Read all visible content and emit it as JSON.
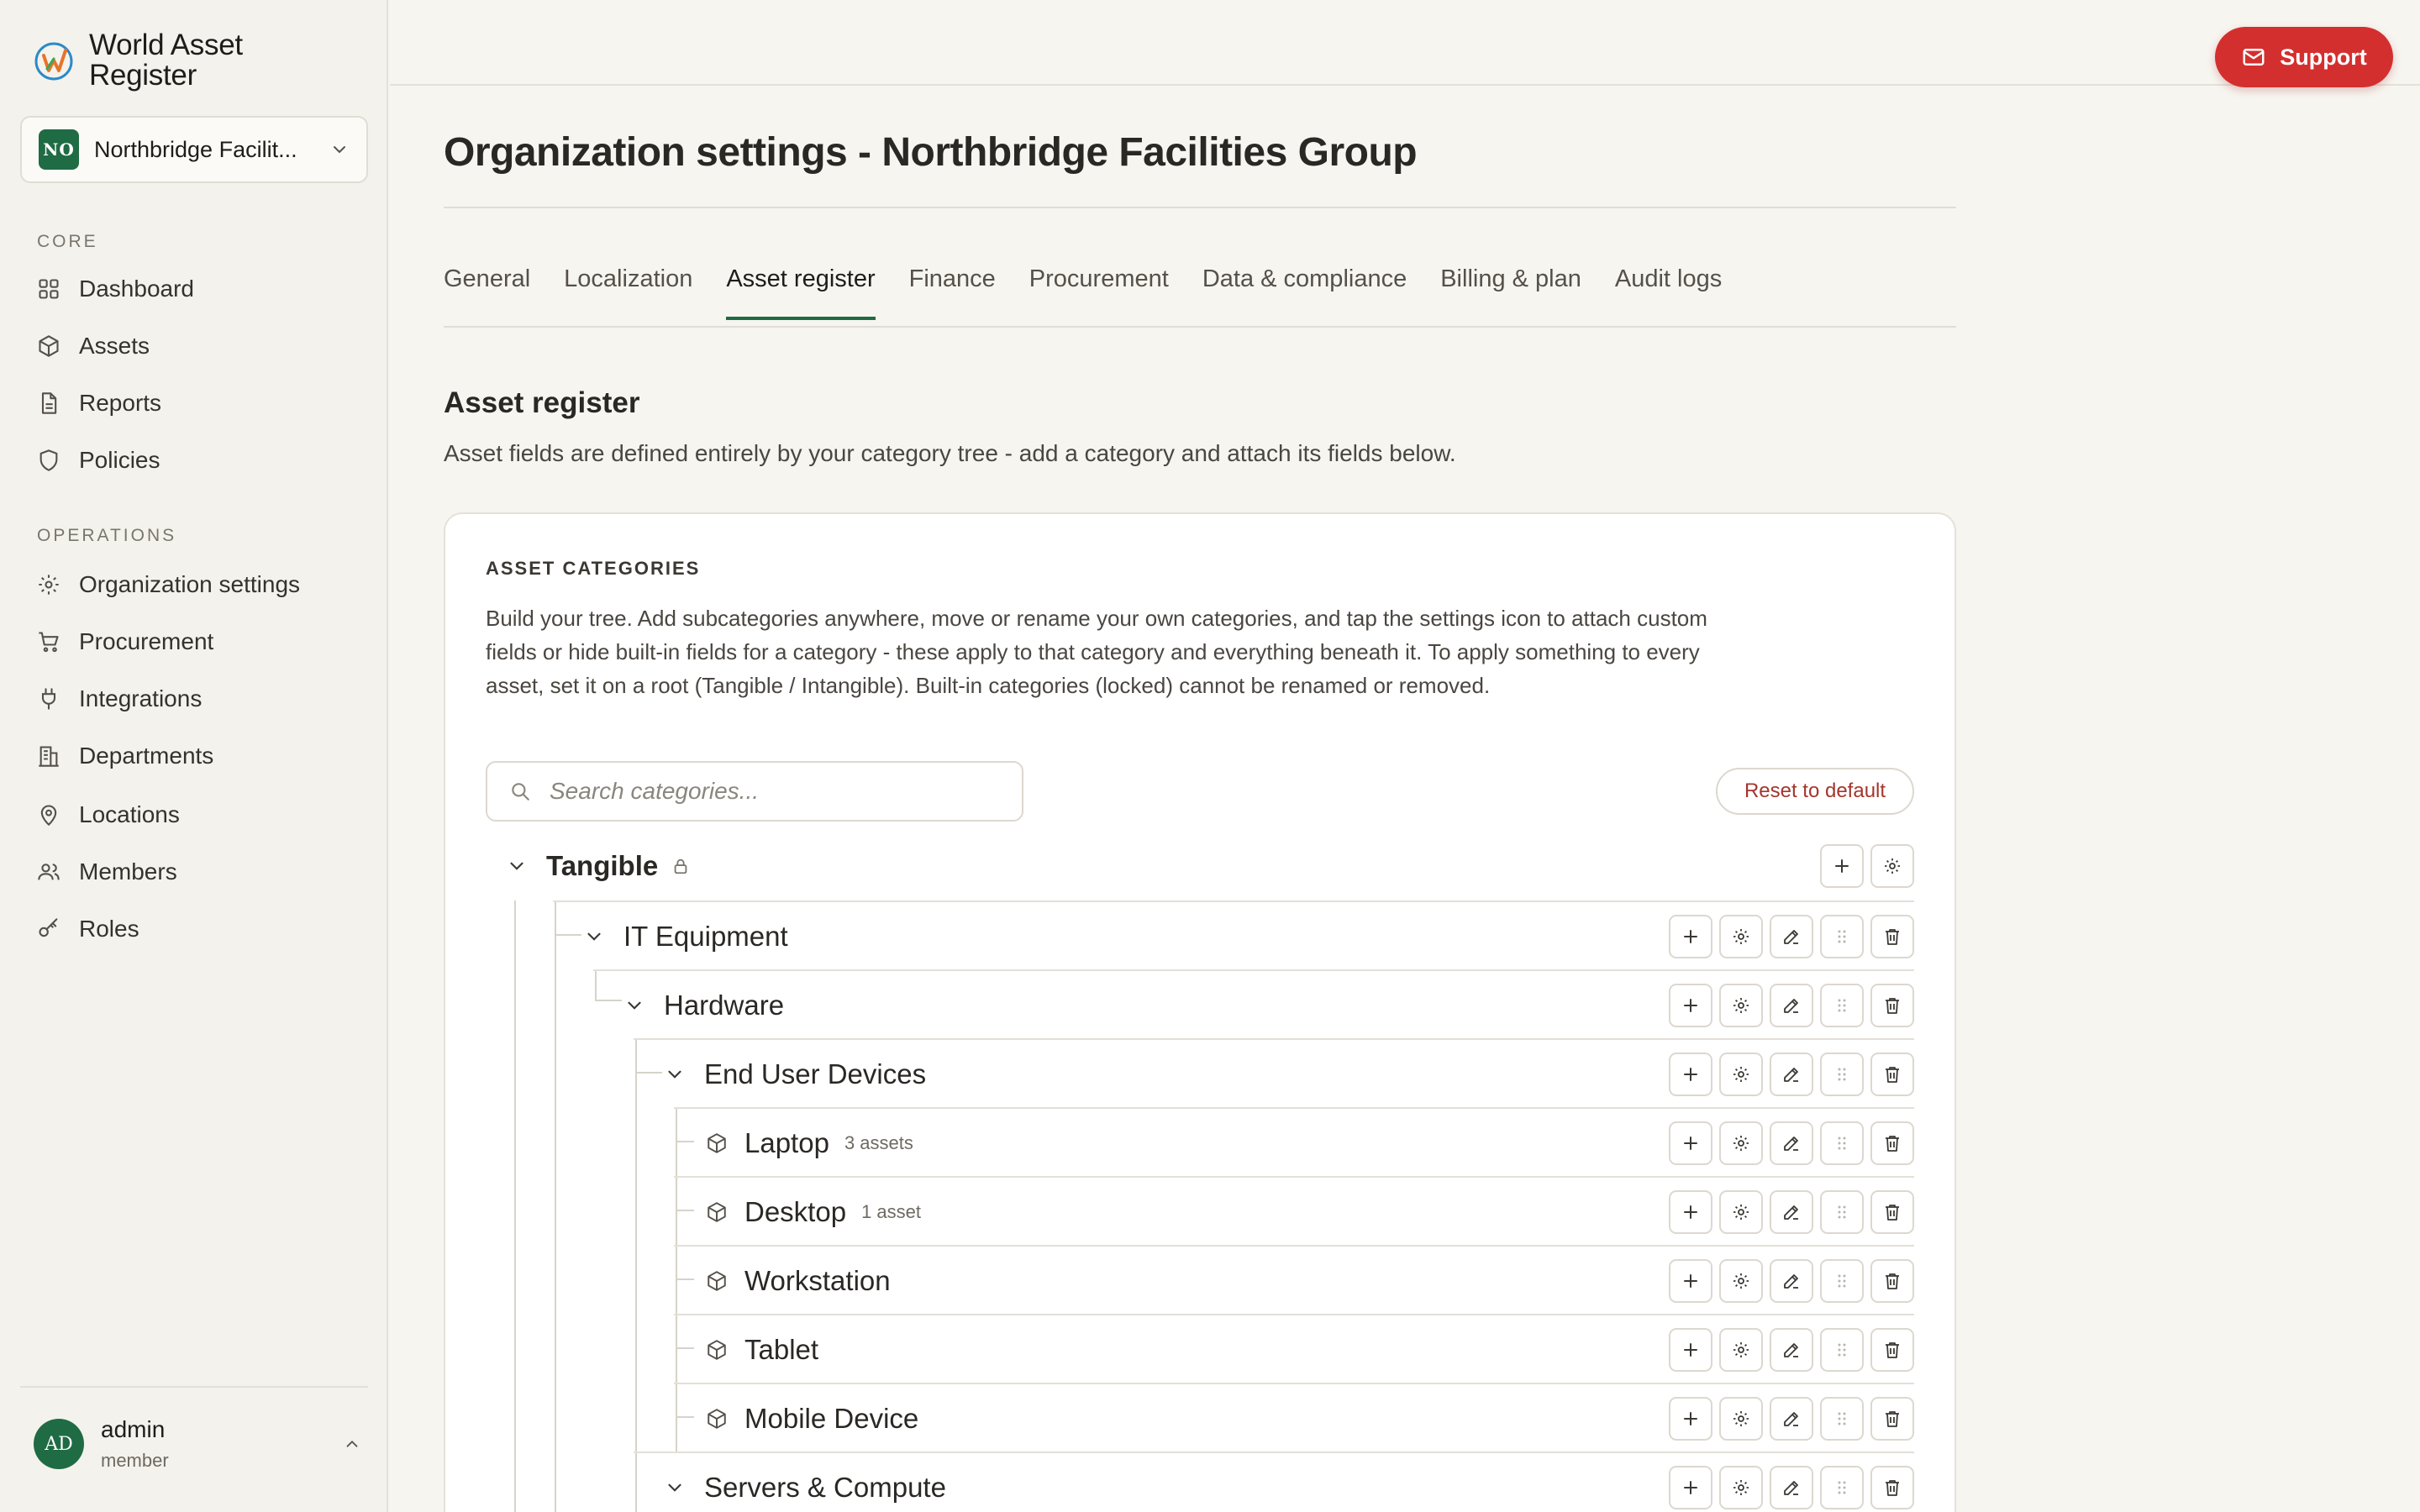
{
  "brand": {
    "name": "World Asset Register"
  },
  "org_switcher": {
    "badge": "NO",
    "name": "Northbridge Facilit..."
  },
  "nav": {
    "core_label": "CORE",
    "core": [
      {
        "label": "Dashboard",
        "icon": "grid-icon"
      },
      {
        "label": "Assets",
        "icon": "cube-icon"
      },
      {
        "label": "Reports",
        "icon": "document-icon"
      },
      {
        "label": "Policies",
        "icon": "shield-icon"
      }
    ],
    "operations_label": "OPERATIONS",
    "operations": [
      {
        "label": "Organization settings",
        "icon": "gear-icon"
      },
      {
        "label": "Procurement",
        "icon": "cart-icon"
      },
      {
        "label": "Integrations",
        "icon": "plug-icon"
      },
      {
        "label": "Departments",
        "icon": "building-icon"
      },
      {
        "label": "Locations",
        "icon": "pin-icon"
      },
      {
        "label": "Members",
        "icon": "users-icon"
      },
      {
        "label": "Roles",
        "icon": "key-icon"
      }
    ]
  },
  "user": {
    "initials": "AD",
    "name": "admin",
    "role": "member"
  },
  "topbar": {
    "support_label": "Support"
  },
  "page": {
    "title": "Organization settings - Northbridge Facilities Group"
  },
  "tabs": [
    "General",
    "Localization",
    "Asset register",
    "Finance",
    "Procurement",
    "Data & compliance",
    "Billing & plan",
    "Audit logs"
  ],
  "active_tab": "Asset register",
  "section": {
    "title": "Asset register",
    "description": "Asset fields are defined entirely by your category tree - add a category and attach its fields below."
  },
  "categories_card": {
    "label": "ASSET CATEGORIES",
    "description": "Build your tree. Add subcategories anywhere, move or rename your own categories, and tap the settings icon to attach custom fields or hide built-in fields for a category - these apply to that category and everything beneath it. To apply something to every asset, set it on a root (Tangible / Intangible). Built-in categories (locked) cannot be renamed or removed.",
    "search_placeholder": "Search categories...",
    "reset_label": "Reset to default"
  },
  "tree": [
    {
      "name": "Tangible",
      "level": 0,
      "expanded": true,
      "locked": true,
      "count": ""
    },
    {
      "name": "IT Equipment",
      "level": 1,
      "expanded": true,
      "count": ""
    },
    {
      "name": "Hardware",
      "level": 2,
      "expanded": true,
      "count": ""
    },
    {
      "name": "End User Devices",
      "level": 3,
      "expanded": true,
      "count": ""
    },
    {
      "name": "Laptop",
      "level": 4,
      "leaf": true,
      "count": "3 assets"
    },
    {
      "name": "Desktop",
      "level": 4,
      "leaf": true,
      "count": "1 asset"
    },
    {
      "name": "Workstation",
      "level": 4,
      "leaf": true,
      "count": ""
    },
    {
      "name": "Tablet",
      "level": 4,
      "leaf": true,
      "count": ""
    },
    {
      "name": "Mobile Device",
      "level": 4,
      "leaf": true,
      "count": ""
    },
    {
      "name": "Servers & Compute",
      "level": 3,
      "expanded": true,
      "count": ""
    }
  ],
  "row_actions": [
    "add-icon",
    "gear-icon",
    "edit-icon",
    "drag-handle-icon",
    "trash-icon"
  ],
  "colors": {
    "brand_green": "#1f6b44",
    "support_red": "#d42f2f",
    "reset_red": "#a3362d"
  }
}
